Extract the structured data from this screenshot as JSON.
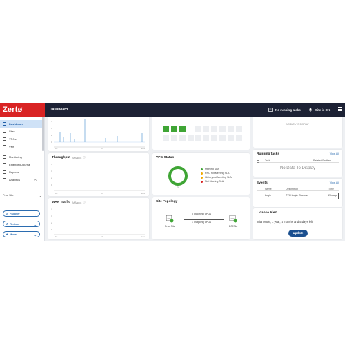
{
  "header": {
    "logo": "Zertø",
    "title": "Dashboard",
    "tasks_label": "No running tasks",
    "site_status": "Site is OK"
  },
  "sidebar": {
    "items": [
      {
        "label": "Dashboard",
        "icon": "dashboard-icon"
      },
      {
        "label": "Sites",
        "icon": "sites-icon"
      },
      {
        "label": "VPGs",
        "icon": "vpgs-icon"
      },
      {
        "label": "VMs",
        "icon": "vms-icon"
      },
      {
        "label": "Monitoring",
        "icon": "monitoring-icon"
      },
      {
        "label": "Extended Journal",
        "icon": "journal-icon"
      },
      {
        "label": "Reports",
        "icon": "reports-icon"
      },
      {
        "label": "Analytics",
        "icon": "analytics-icon"
      }
    ],
    "site_select": "Prod Site",
    "actions": [
      {
        "label": "Failover",
        "icon": "failover-icon"
      },
      {
        "label": "Restore",
        "icon": "restore-icon"
      },
      {
        "label": "Move",
        "icon": "move-icon"
      }
    ]
  },
  "charts": {
    "top": {
      "x_ticks": [
        "1h",
        "1h",
        "Now"
      ]
    },
    "throughput": {
      "title": "Throughput",
      "unit": "(MB/sec)",
      "x_ticks": [
        "1h",
        "1h",
        "Now"
      ]
    },
    "wan": {
      "title": "WAN Traffic",
      "unit": "(MB/sec)",
      "x_ticks": [
        "1h",
        "1h",
        "Now"
      ]
    }
  },
  "vpg_status": {
    "title": "VPG Status",
    "count": "1",
    "legend": [
      {
        "label": "Meeting SLA",
        "color": "#3fa535"
      },
      {
        "label": "RPO not Meeting SLA",
        "color": "#f2a900"
      },
      {
        "label": "History not Meeting SLA",
        "color": "#f2a900"
      },
      {
        "label": "Not Meeting SLA",
        "color": "#d92323"
      }
    ]
  },
  "site_topology": {
    "title": "Site Topology",
    "incoming": "0 Incoming VPGs",
    "outgoing": "1 Outgoing VPGs",
    "local_site": "Prod Site",
    "remote_site": "DR Site"
  },
  "top_right": {
    "no_data": "NO DATA TO DISPLAY"
  },
  "running_tasks": {
    "title": "Running tasks",
    "view_all": "View All",
    "col_task": "Task",
    "col_related": "Related Entities",
    "no_data": "No Data To Display"
  },
  "events": {
    "title": "Events",
    "view_all": "View All",
    "col_name": "Name",
    "col_desc": "Description",
    "col_time": "Time",
    "rows": [
      {
        "name": "Login",
        "description": "ZVM Login: Success",
        "time": "20s ago"
      }
    ]
  },
  "license": {
    "title": "License Alert",
    "message": "Trial Mode, 1 year, 4 months and 5 days left",
    "button": "Update"
  }
}
